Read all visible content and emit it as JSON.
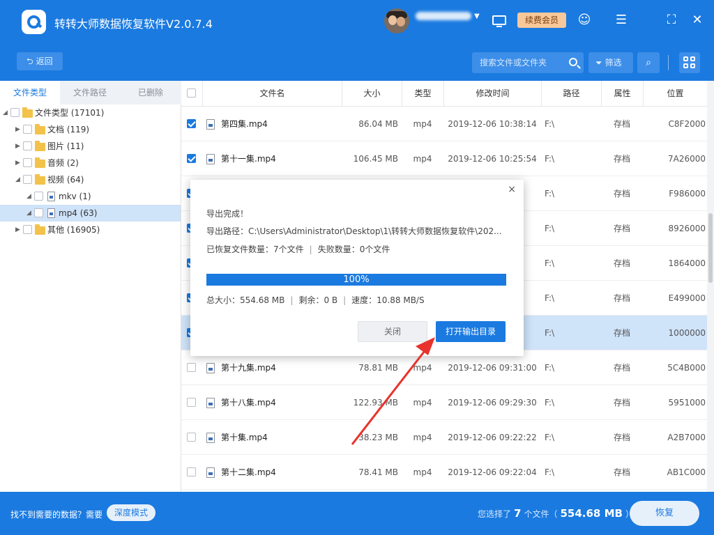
{
  "app": {
    "title": "转转大师数据恢复软件V2.0.7.4",
    "vip_label": "续费会员"
  },
  "toolbar": {
    "back_label": "返回",
    "search_placeholder": "搜索文件或文件夹",
    "filter_label": "筛选"
  },
  "left_tabs": [
    "文件类型",
    "文件路径",
    "已删除"
  ],
  "tree": [
    {
      "label": "文件类型 (17101)"
    },
    {
      "label": "文档 (119)"
    },
    {
      "label": "图片 (11)"
    },
    {
      "label": "音频 (2)"
    },
    {
      "label": "视频 (64)"
    },
    {
      "label": "mkv (1)"
    },
    {
      "label": "mp4 (63)"
    },
    {
      "label": "其他 (16905)"
    }
  ],
  "columns": [
    "文件名",
    "大小",
    "类型",
    "修改时间",
    "路径",
    "属性",
    "位置"
  ],
  "rows": [
    {
      "name": "第四集.mp4",
      "size": "86.04 MB",
      "type": "mp4",
      "time": "2019-12-06 10:38:14",
      "path": "F:\\",
      "attr": "存档",
      "pos": "C8F2000",
      "checked": true
    },
    {
      "name": "第十一集.mp4",
      "size": "106.45 MB",
      "type": "mp4",
      "time": "2019-12-06 10:25:54",
      "path": "F:\\",
      "attr": "存档",
      "pos": "7A26000",
      "checked": true
    },
    {
      "name": "",
      "size": "",
      "type": "",
      "time": "34",
      "path": "F:\\",
      "attr": "存档",
      "pos": "F986000",
      "checked": true
    },
    {
      "name": "",
      "size": "",
      "type": "",
      "time": "54",
      "path": "F:\\",
      "attr": "存档",
      "pos": "8926000",
      "checked": true
    },
    {
      "name": "",
      "size": "",
      "type": "",
      "time": "10",
      "path": "F:\\",
      "attr": "存档",
      "pos": "1864000",
      "checked": true
    },
    {
      "name": "",
      "size": "",
      "type": "",
      "time": "26",
      "path": "F:\\",
      "attr": "存档",
      "pos": "E499000",
      "checked": true
    },
    {
      "name": "",
      "size": "",
      "type": "",
      "time": "50",
      "path": "F:\\",
      "attr": "存档",
      "pos": "1000000",
      "checked": true
    },
    {
      "name": "第十九集.mp4",
      "size": "78.81 MB",
      "type": "mp4",
      "time": "2019-12-06 09:31:00",
      "path": "F:\\",
      "attr": "存档",
      "pos": "5C4B000",
      "checked": false
    },
    {
      "name": "第十八集.mp4",
      "size": "122.93 MB",
      "type": "mp4",
      "time": "2019-12-06 09:29:30",
      "path": "F:\\",
      "attr": "存档",
      "pos": "5951000",
      "checked": false
    },
    {
      "name": "第十集.mp4",
      "size": "38.23 MB",
      "type": "mp4",
      "time": "2019-12-06 09:22:22",
      "path": "F:\\",
      "attr": "存档",
      "pos": "A2B7000",
      "checked": false
    },
    {
      "name": "第十二集.mp4",
      "size": "78.41 MB",
      "type": "mp4",
      "time": "2019-12-06 09:22:04",
      "path": "F:\\",
      "attr": "存档",
      "pos": "AB1C000",
      "checked": false
    }
  ],
  "bottom": {
    "hint": "找不到需要的数据？需要",
    "deep_mode": "深度模式",
    "selected_prefix": "您选择了",
    "selected_count": "7",
    "selected_mid": "个文件（",
    "selected_size": "554.68 MB",
    "selected_suffix": "）",
    "recover": "恢复"
  },
  "modal": {
    "close_icon": "×",
    "line1": "导出完成！",
    "line2": "导出路径：C:\\Users\\Administrator\\Desktop\\1\\转转大师数据恢复软件\\202...",
    "recovered": "已恢复文件数量：7个文件",
    "failed": "失败数量：0个文件",
    "progress_percent": 100,
    "progress_text": "100%",
    "total": "总大小：554.68 MB",
    "remaining": "剩余：0 B",
    "speed": "速度：10.88 MB/S",
    "close_btn": "关闭",
    "open_btn": "打开输出目录"
  },
  "colors": {
    "primary": "#1a7ae0",
    "selected_row": "#cfe3f9",
    "annotation_arrow": "#e8322c"
  }
}
